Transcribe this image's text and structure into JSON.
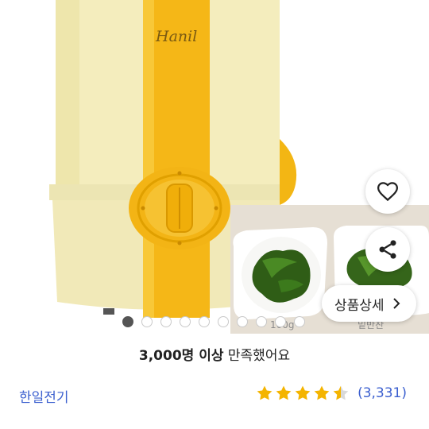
{
  "gallery": {
    "brand_logo_text": "Hanil",
    "food_caption_left": "100g",
    "food_caption_right": "밑반찬",
    "dots_total": 10,
    "dots_active_index": 0,
    "detail_button_label": "상품상세"
  },
  "satisfaction": {
    "strong_text": "3,000명 이상",
    "rest_text": "만족했어요"
  },
  "product": {
    "brand": "한일전기",
    "rating_value": 4.5,
    "rating_max": 5,
    "review_count": "(3,331)"
  },
  "colors": {
    "accent_blue": "#3b5fcf",
    "star_yellow": "#f4b400",
    "appliance_cream": "#f3ecb8",
    "appliance_yellow": "#f2b91a"
  },
  "icons": {
    "heart": "heart-icon",
    "share": "share-icon",
    "chevron": "chevron-right-icon",
    "star": "star-icon"
  }
}
